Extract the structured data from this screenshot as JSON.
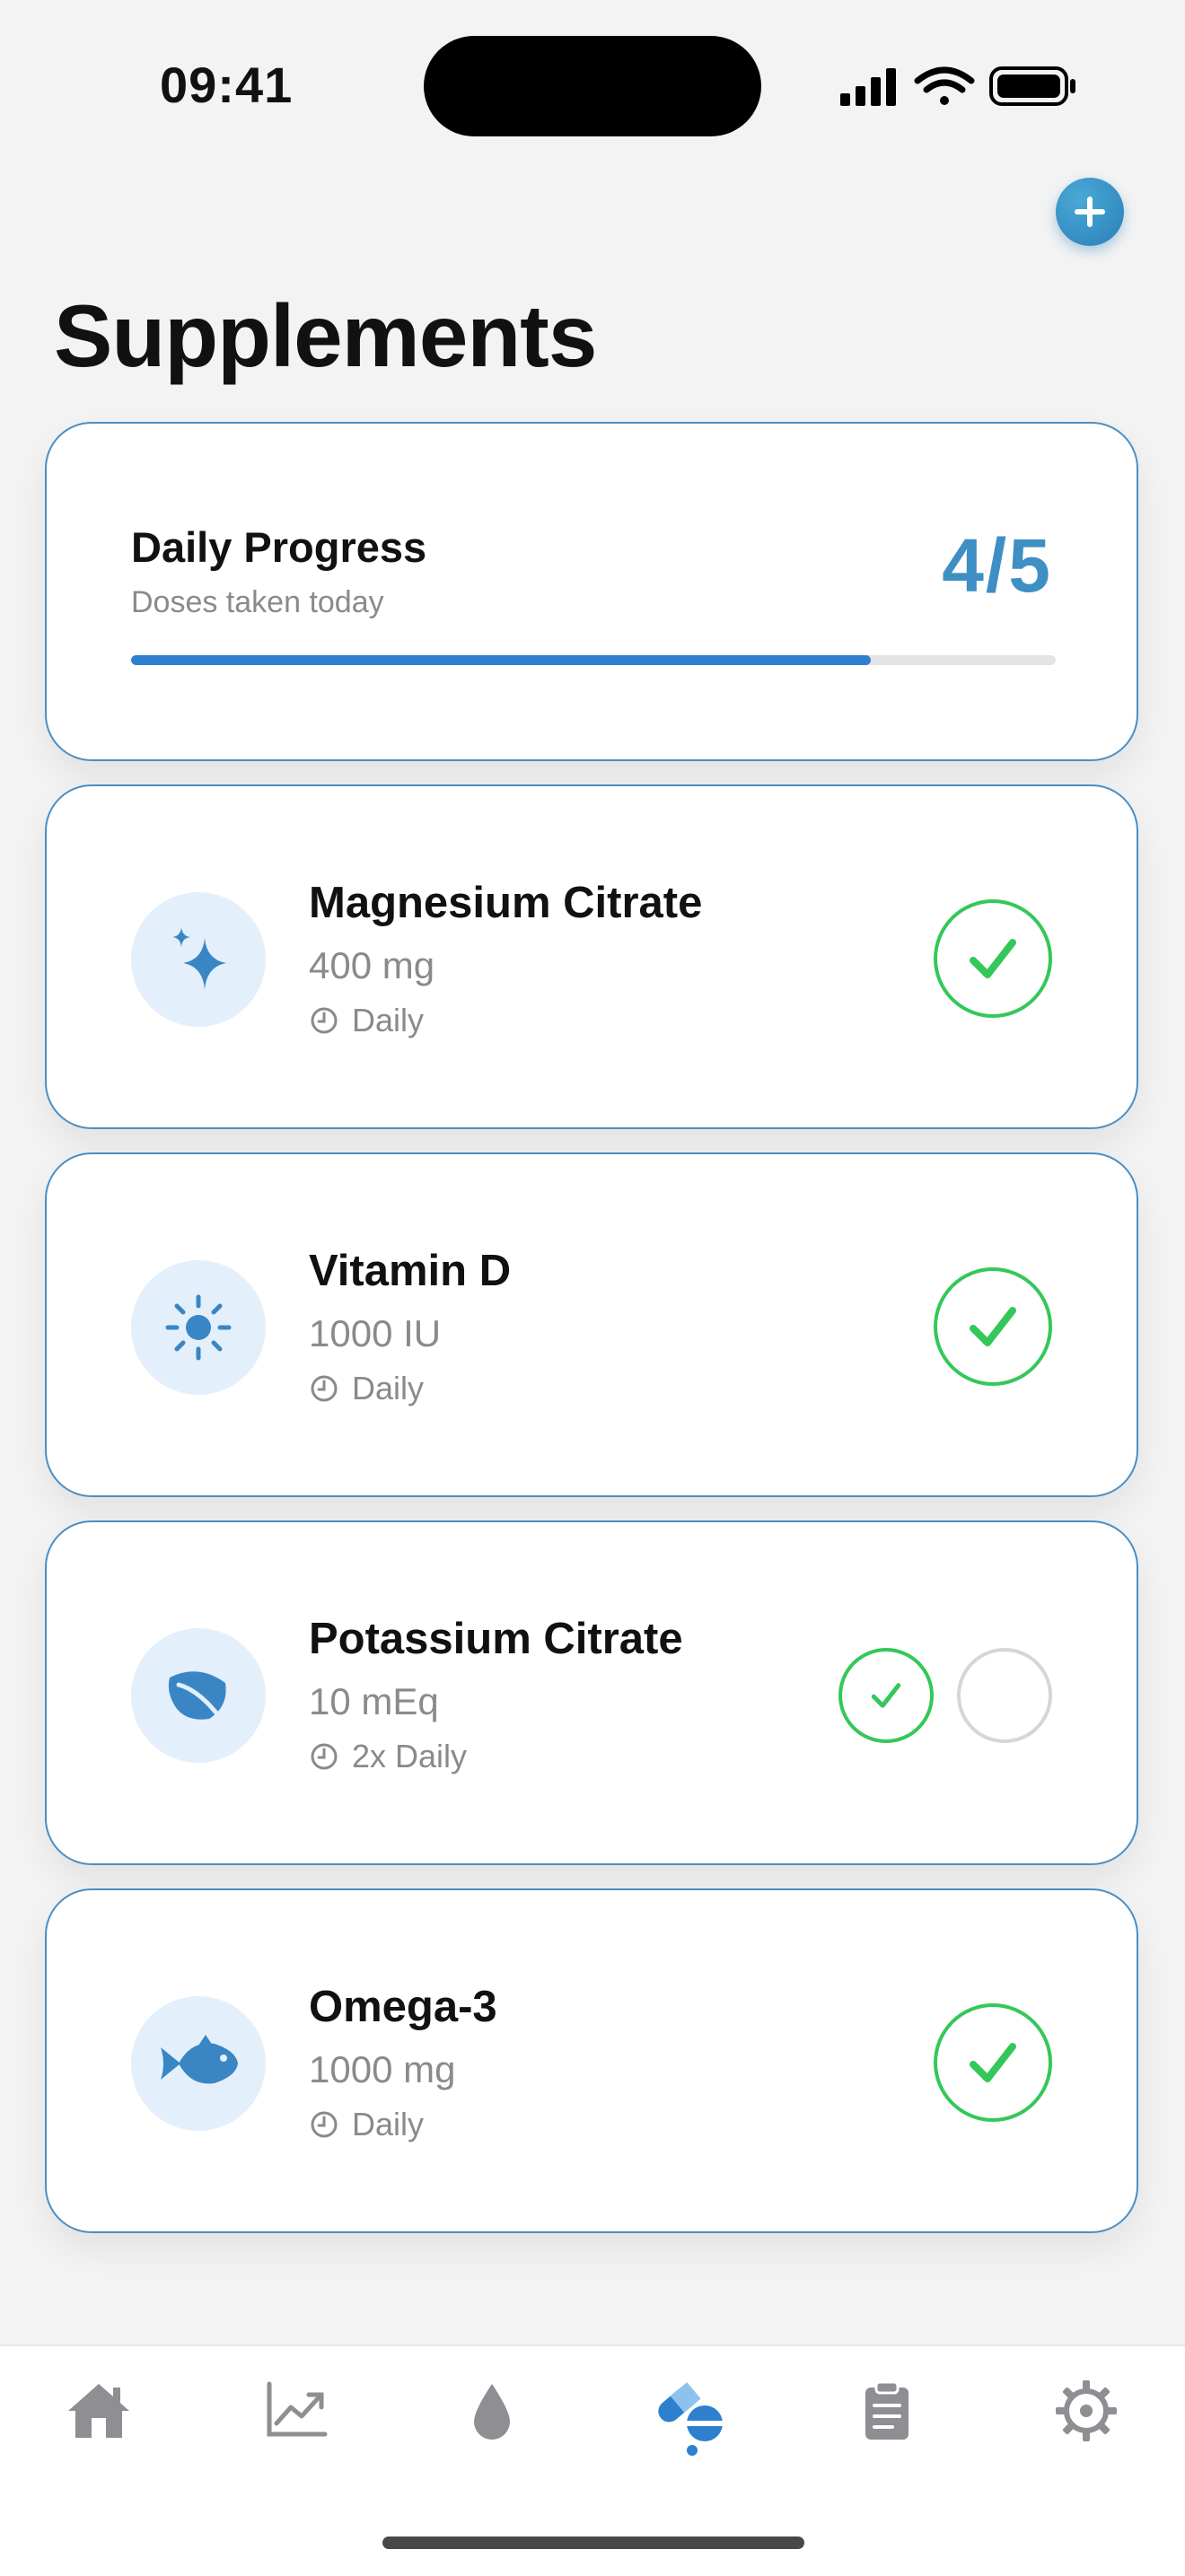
{
  "status": {
    "time": "09:41"
  },
  "header": {
    "title": "Supplements",
    "add_icon": "plus-icon"
  },
  "progress": {
    "title": "Daily Progress",
    "subtitle": "Doses taken today",
    "count": "4/5",
    "fraction": 0.8
  },
  "supplements": [
    {
      "name": "Magnesium Citrate",
      "dose": "400 mg",
      "schedule": "Daily",
      "icon": "sparkles-icon",
      "doses": [
        true
      ]
    },
    {
      "name": "Vitamin D",
      "dose": "1000 IU",
      "schedule": "Daily",
      "icon": "sun-icon",
      "doses": [
        true
      ]
    },
    {
      "name": "Potassium Citrate",
      "dose": "10 mEq",
      "schedule": "2x Daily",
      "icon": "leaf-icon",
      "doses": [
        true,
        false
      ]
    },
    {
      "name": "Omega-3",
      "dose": "1000 mg",
      "schedule": "Daily",
      "icon": "fish-icon",
      "doses": [
        true
      ]
    }
  ],
  "tab_bar": {
    "items": [
      "home-icon",
      "chart-icon",
      "drop-icon",
      "pills-icon",
      "clipboard-icon",
      "gear-icon"
    ],
    "active": "pills-icon"
  },
  "colors": {
    "accent": "#3e8fc4",
    "check": "#34c759",
    "bar_fill": "#2f7fcf"
  }
}
